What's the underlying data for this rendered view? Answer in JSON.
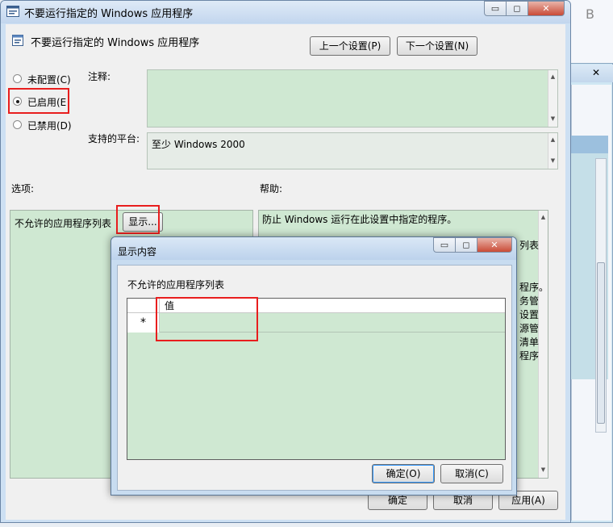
{
  "background_window": {
    "letter": "B",
    "close_glyph": "✕"
  },
  "main_window": {
    "title": "不要运行指定的 Windows 应用程序",
    "min_glyph": "▭",
    "max_glyph": "◻",
    "close_glyph": "✕"
  },
  "policy": {
    "name": "不要运行指定的 Windows 应用程序",
    "prev_label": "上一个设置(P)",
    "next_label": "下一个设置(N)",
    "radios": [
      {
        "label": "未配置(C)",
        "checked": false
      },
      {
        "label": "已启用(E",
        "checked": true
      },
      {
        "label": "已禁用(D)",
        "checked": false
      }
    ],
    "comment_label": "注释:",
    "platform_label": "支持的平台:",
    "platform_value": "至少 Windows 2000"
  },
  "options": {
    "label": "选项:",
    "field_label": "不允许的应用程序列表",
    "show_label": "显示..."
  },
  "help": {
    "label": "帮助:",
    "text": "防止 Windows 运行在此设置中指定的程序。",
    "right_fragments": [
      "列表",
      "程序。",
      "务管",
      "设置",
      "源管",
      "清单",
      "程序"
    ]
  },
  "footer": {
    "ok_label": "确定",
    "cancel_label": "取消",
    "apply_label": "应用(A)"
  },
  "dialog": {
    "title": "显示内容",
    "field_label": "不允许的应用程序列表",
    "column_header": "值",
    "new_row_marker": "*",
    "ok_label": "确定(O)",
    "cancel_label": "取消(C)"
  },
  "colors": {
    "highlight": "#e81e1e",
    "field_bg": "#cfe8d2"
  }
}
